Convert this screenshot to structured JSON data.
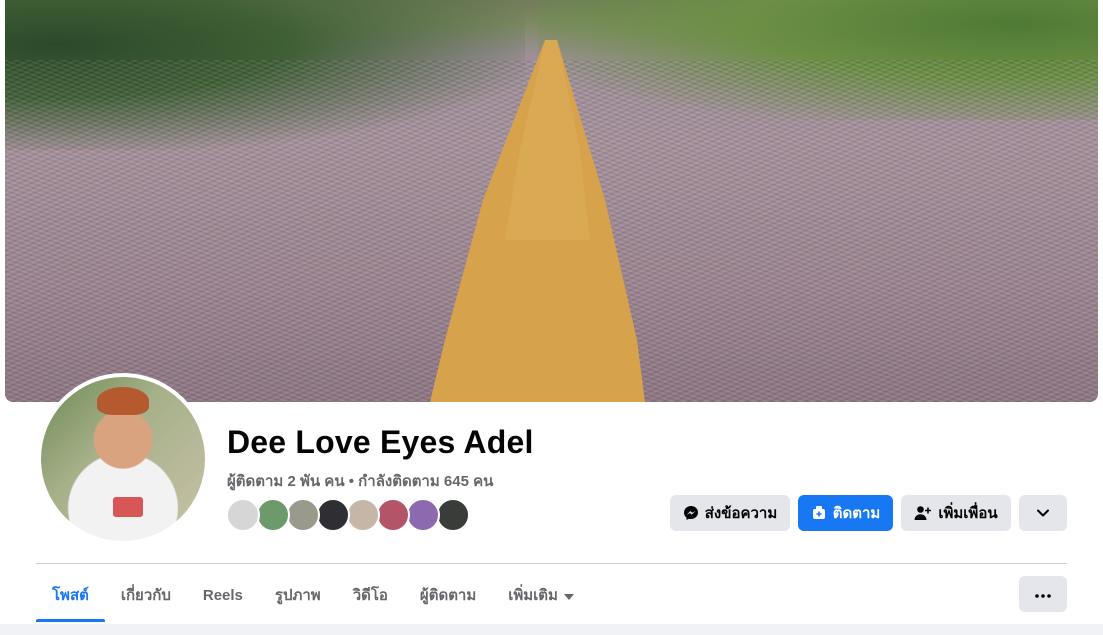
{
  "profile": {
    "name": "Dee Love Eyes Adel",
    "follow_stats": "ผู้ติดตาม 2 พัน คน • กำลังติดตาม 645 คน",
    "friend_avatar_colors": [
      "#d6d6d6",
      "#6d9a6a",
      "#9a9a8c",
      "#2f2f33",
      "#c6b6a8",
      "#b35468",
      "#8d6ab0",
      "#3a3c3a"
    ]
  },
  "actions": {
    "message_label": "ส่งข้อความ",
    "follow_label": "ติดตาม",
    "add_friend_label": "เพิ่มเพื่อน"
  },
  "tabs": [
    {
      "label": "โพสต์",
      "active": true
    },
    {
      "label": "เกี่ยวกับ"
    },
    {
      "label": "Reels"
    },
    {
      "label": "รูปภาพ"
    },
    {
      "label": "วิดีโอ"
    },
    {
      "label": "ผู้ติดตาม"
    },
    {
      "label": "เพิ่มเติม"
    }
  ],
  "colors": {
    "accent": "#1877f2",
    "button_gray": "#e4e6eb",
    "secondary_text": "#65676b"
  },
  "icons": {
    "message": "messenger-icon",
    "follow": "follow-icon",
    "add_friend": "add-friend-icon",
    "dropdown": "chevron-down-icon",
    "more": "more-dots-icon",
    "tab_dropdown": "caret-down-icon"
  }
}
